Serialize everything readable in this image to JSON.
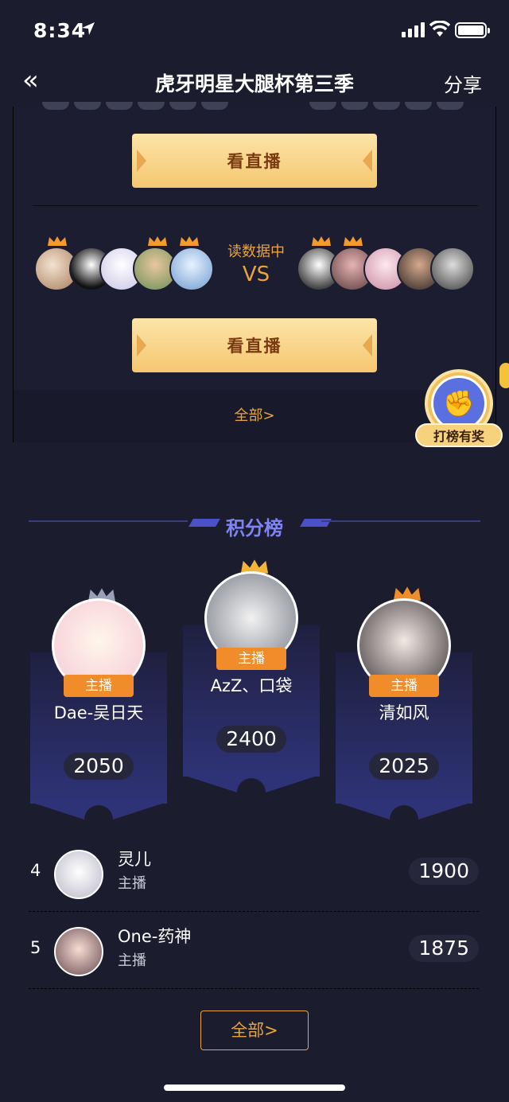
{
  "status": {
    "time": "8:34"
  },
  "nav": {
    "back": "«",
    "title": "虎牙明星大腿杯第三季",
    "share": "分享"
  },
  "match": {
    "watch_label": "看直播",
    "status_text": "读数据中",
    "vs_text": "VS",
    "all_label": "全部>"
  },
  "float_badge": {
    "label": "打榜有奖",
    "icon": "fist-icon"
  },
  "ranking": {
    "title": "积分榜",
    "role_tag": "主播",
    "podium": [
      {
        "rank": 1,
        "name": "AzZ、口袋",
        "score": "2400"
      },
      {
        "rank": 2,
        "name": "Dae-吴日天",
        "score": "2050"
      },
      {
        "rank": 3,
        "name": "清如风",
        "score": "2025"
      }
    ],
    "list": [
      {
        "rank": "4",
        "name": "灵儿",
        "role": "主播",
        "score": "1900"
      },
      {
        "rank": "5",
        "name": "One-药神",
        "role": "主播",
        "score": "1875"
      }
    ],
    "all_label": "全部>"
  },
  "colors": {
    "accent": "#e9a43b",
    "title_purple": "#7f84f5",
    "tag_orange": "#f08c2a",
    "bg": "#1b1c2e"
  }
}
